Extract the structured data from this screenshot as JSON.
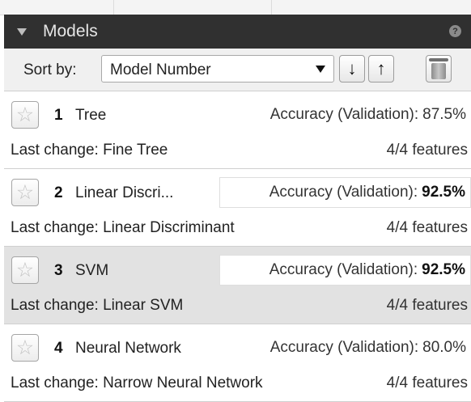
{
  "panel": {
    "title": "Models"
  },
  "sort": {
    "label": "Sort by:",
    "selected": "Model Number",
    "descending_icon": "sort-descending-arrow-icon",
    "ascending_icon": "sort-ascending-arrow-icon",
    "delete_icon": "trash-icon"
  },
  "models": [
    {
      "number": "1",
      "name": "Tree",
      "accuracy_label": "Accuracy (Validation):",
      "accuracy": "87.5%",
      "accuracy_best": false,
      "last_change": "Last change: Fine Tree",
      "features": "4/4 features"
    },
    {
      "number": "2",
      "name": "Linear Discri...",
      "accuracy_label": "Accuracy (Validation):",
      "accuracy": "92.5%",
      "accuracy_best": true,
      "last_change": "Last change: Linear Discriminant",
      "features": "4/4 features"
    },
    {
      "number": "3",
      "name": "SVM",
      "accuracy_label": "Accuracy (Validation):",
      "accuracy": "92.5%",
      "accuracy_best": true,
      "selected": true,
      "last_change": "Last change: Linear SVM",
      "features": "4/4 features"
    },
    {
      "number": "4",
      "name": "Neural Network",
      "accuracy_label": "Accuracy (Validation):",
      "accuracy": "80.0%",
      "accuracy_best": false,
      "last_change": "Last change: Narrow Neural Network",
      "features": "4/4 features"
    }
  ]
}
